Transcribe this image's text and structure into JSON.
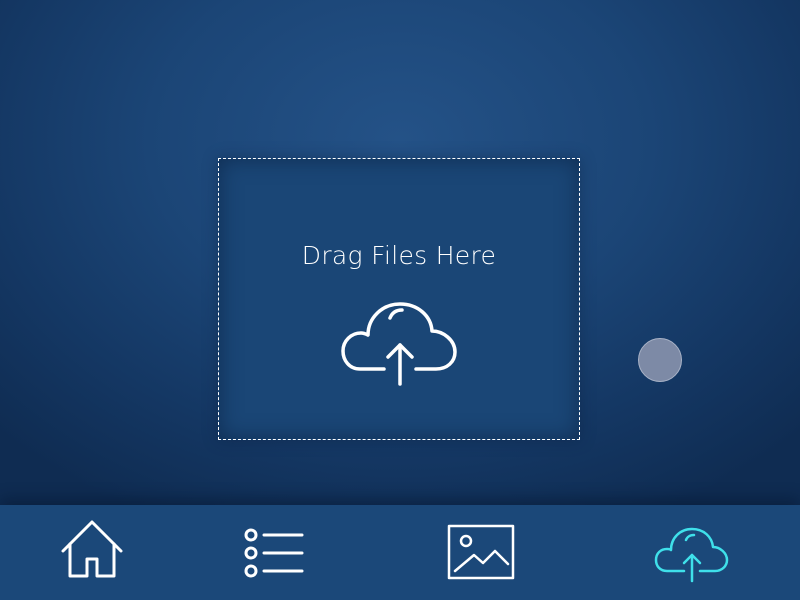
{
  "dropzone": {
    "title": "Drag Files Here",
    "icon": "cloud-upload-icon"
  },
  "tabbar": {
    "tabs": [
      {
        "icon": "home-icon",
        "active": false
      },
      {
        "icon": "list-icon",
        "active": false
      },
      {
        "icon": "image-icon",
        "active": false
      },
      {
        "icon": "cloud-upload-icon",
        "active": true
      }
    ],
    "active_color": "#3fe0ea",
    "inactive_color": "#ffffff"
  },
  "colors": {
    "background": "#1b4576",
    "tabbar": "#1b4879",
    "dropzone_border": "#ffffff"
  }
}
